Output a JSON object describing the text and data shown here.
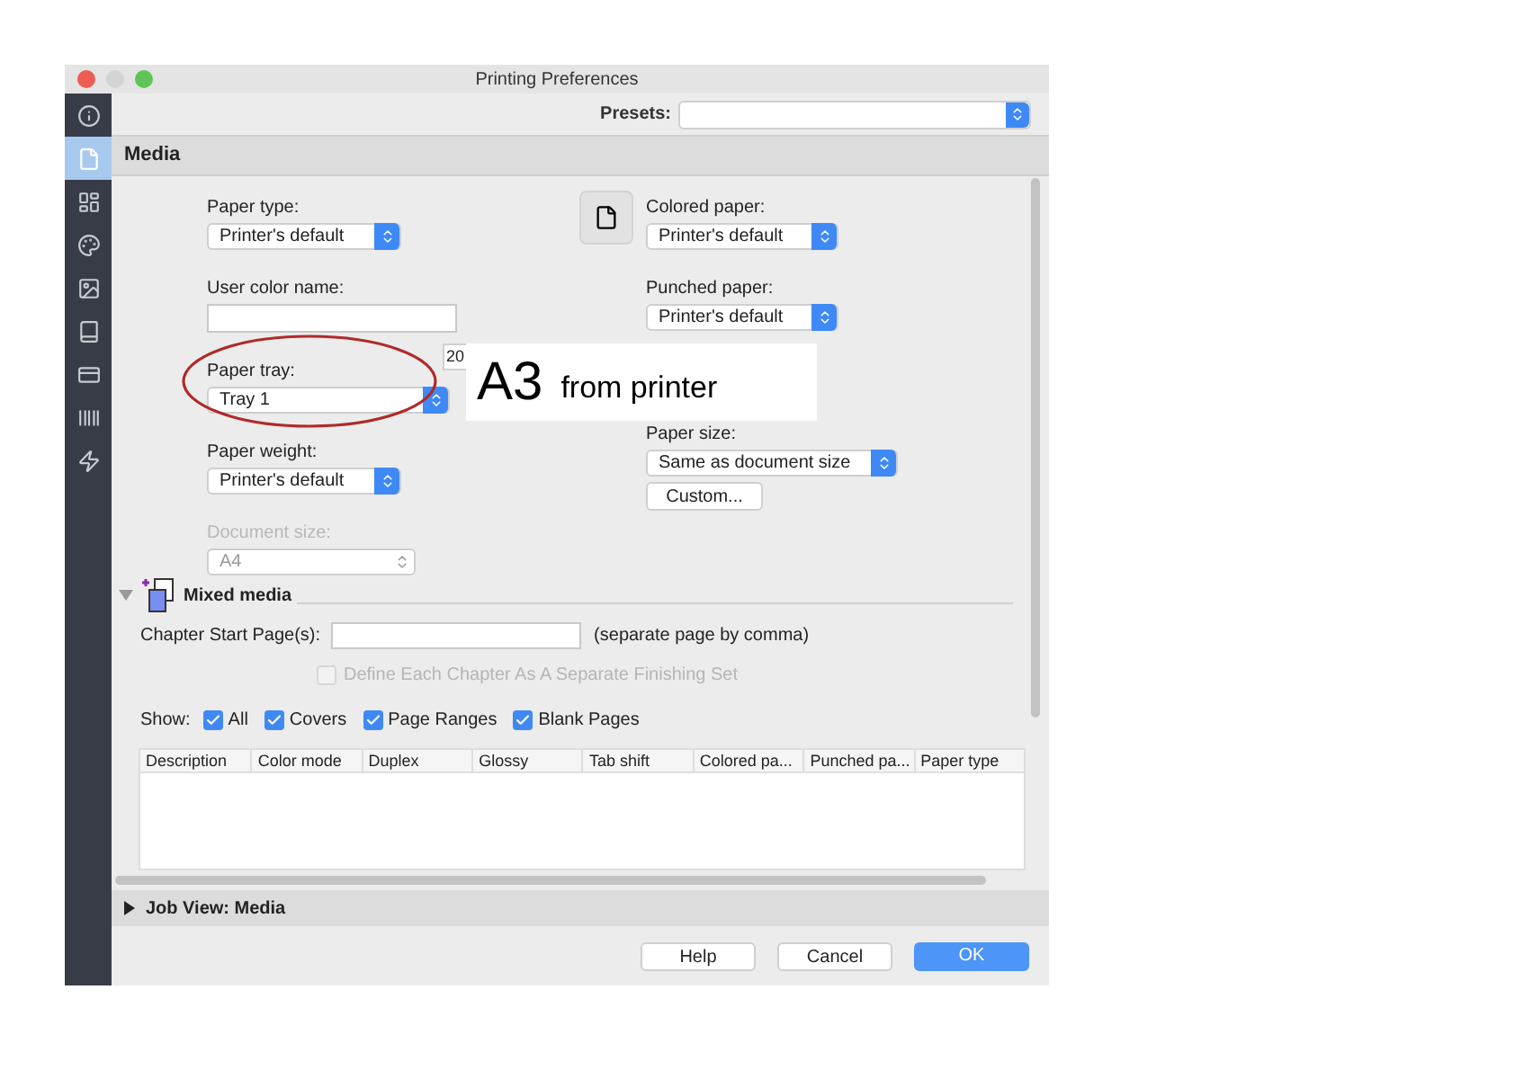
{
  "window": {
    "title": "Printing Preferences"
  },
  "sidebar": {
    "items": [
      {
        "kind": "info",
        "selected": false
      },
      {
        "kind": "document",
        "selected": true
      },
      {
        "kind": "layout",
        "selected": false
      },
      {
        "kind": "palette",
        "selected": false
      },
      {
        "kind": "image",
        "selected": false
      },
      {
        "kind": "book",
        "selected": false
      },
      {
        "kind": "card",
        "selected": false
      },
      {
        "kind": "barcode",
        "selected": false
      },
      {
        "kind": "bolt",
        "selected": false
      }
    ]
  },
  "presets": {
    "label": "Presets:"
  },
  "section": {
    "title": "Media"
  },
  "left_fields": [
    {
      "kind": "select",
      "label": "Paper type:",
      "value": "Printer's default",
      "disabled": false
    },
    {
      "kind": "text",
      "label": "User color name:",
      "disabled": false
    },
    {
      "kind": "select",
      "label": "Paper tray:",
      "value": "Tray 1",
      "disabled": false
    },
    {
      "kind": "select",
      "label": "Paper weight:",
      "value": "Printer's default",
      "disabled": false
    },
    {
      "kind": "select",
      "label": "Document size:",
      "value": "A4",
      "disabled": true
    }
  ],
  "right_fields": [
    {
      "kind": "select",
      "label": "Colored paper:",
      "value": "Printer's default"
    },
    {
      "kind": "select",
      "label": "Punched paper:",
      "value": "Printer's default"
    },
    {
      "kind": "select",
      "label": "Paper size:",
      "value": "Same as document size"
    }
  ],
  "custom_button": "Custom...",
  "partial_field": {
    "value": "20"
  },
  "callout": {
    "big": "A3",
    "small": "from printer"
  },
  "mixed_media": {
    "title": "Mixed media",
    "expanded": true,
    "chapter_label": "Chapter Start Page(s):",
    "chapter_hint": "(separate page by comma)",
    "define_checkbox": {
      "label": "Define Each Chapter As A Separate Finishing Set",
      "checked": false,
      "disabled": true
    },
    "show_label": "Show:",
    "show_options": [
      {
        "label": "All",
        "checked": true
      },
      {
        "label": "Covers",
        "checked": true
      },
      {
        "label": "Page Ranges",
        "checked": true
      },
      {
        "label": "Blank Pages",
        "checked": true
      }
    ],
    "table": {
      "columns": [
        "Description",
        "Color mode",
        "Duplex",
        "Glossy",
        "Tab shift",
        "Colored pa...",
        "Punched pa...",
        "Paper type"
      ]
    }
  },
  "job_view": {
    "title": "Job View: Media",
    "expanded": false
  },
  "buttons": [
    {
      "label": "Help",
      "kind": "plain"
    },
    {
      "label": "Cancel",
      "kind": "plain"
    },
    {
      "label": "OK",
      "kind": "primary"
    }
  ]
}
